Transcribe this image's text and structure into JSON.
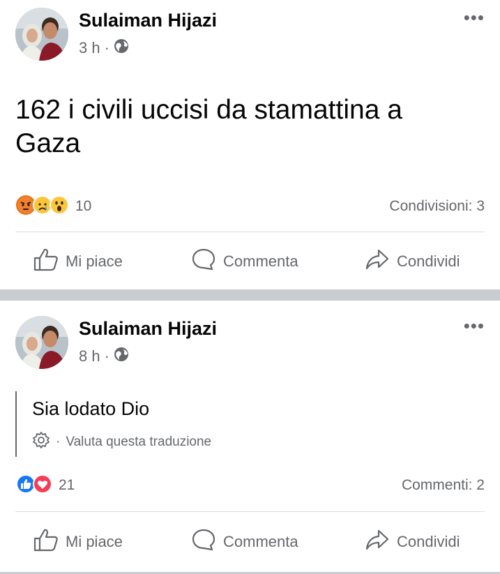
{
  "posts": [
    {
      "author": "Sulaiman Hijazi",
      "time": "3 h",
      "separator": "·",
      "privacy_icon": "globe-icon",
      "text": "162 i civili uccisi da stamattina a Gaza",
      "reactions": [
        "angry",
        "sad",
        "wow"
      ],
      "reaction_count": "10",
      "counter_text": "Condivisioni: 3",
      "more_label": "•••"
    },
    {
      "author": "Sulaiman Hijazi",
      "time": "8 h",
      "separator": "·",
      "privacy_icon": "globe-icon",
      "translated_text": "Sia lodato Dio",
      "rate_translation": "Valuta questa traduzione",
      "rate_separator": "·",
      "reactions": [
        "like",
        "love"
      ],
      "reaction_count": "21",
      "counter_text": "Commenti: 2",
      "more_label": "•••"
    }
  ],
  "actions": {
    "like": "Mi piace",
    "comment": "Commenta",
    "share": "Condividi"
  },
  "colors": {
    "text": "#050505",
    "secondary": "#65676b",
    "divider_band": "#c9ccd1",
    "like_blue": "#1877f2",
    "love_red": "#f33e58",
    "emoji_yellow": "#fcc63b",
    "angry_orange": "#e9710f"
  }
}
